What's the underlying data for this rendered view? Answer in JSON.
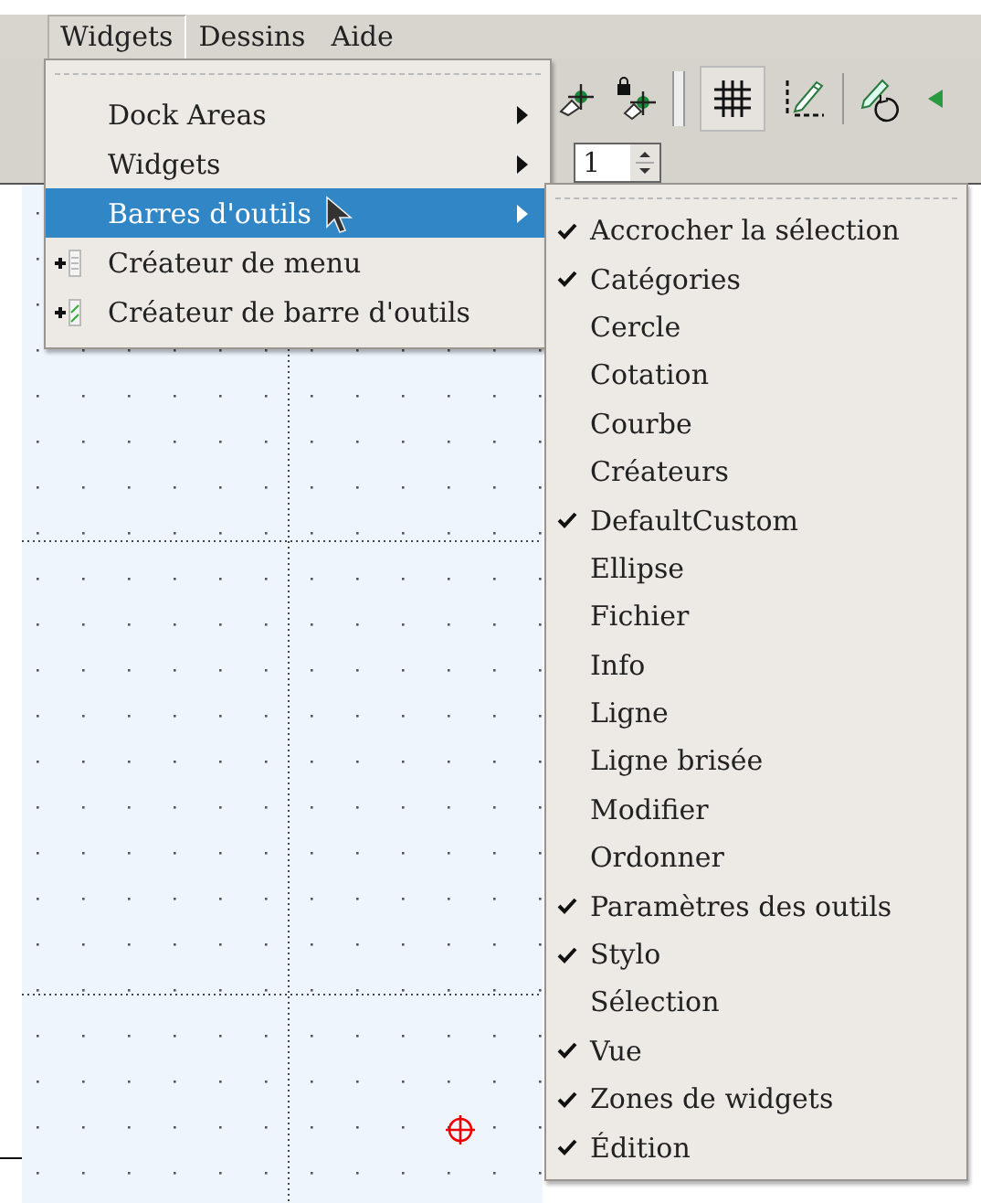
{
  "menubar": [
    {
      "label": "Widgets",
      "selected": true
    },
    {
      "label": "Dessins",
      "selected": false
    },
    {
      "label": "Aide",
      "selected": false
    }
  ],
  "toolbar": {
    "spin_value": "1"
  },
  "widgets_menu": [
    {
      "kind": "submenu",
      "label": "Dock Areas",
      "selected": false
    },
    {
      "kind": "submenu",
      "label": "Widgets",
      "selected": false
    },
    {
      "kind": "submenu",
      "label": "Barres d'outils",
      "selected": true
    },
    {
      "kind": "action",
      "label": "Créateur de menu",
      "selected": false
    },
    {
      "kind": "action",
      "label": "Créateur de barre d'outils",
      "selected": false
    }
  ],
  "toolbars_submenu": [
    {
      "label": "Accrocher la sélection",
      "checked": true
    },
    {
      "label": "Catégories",
      "checked": true
    },
    {
      "label": "Cercle",
      "checked": false
    },
    {
      "label": "Cotation",
      "checked": false
    },
    {
      "label": "Courbe",
      "checked": false
    },
    {
      "label": "Créateurs",
      "checked": false
    },
    {
      "label": "DefaultCustom",
      "checked": true
    },
    {
      "label": "Ellipse",
      "checked": false
    },
    {
      "label": "Fichier",
      "checked": false
    },
    {
      "label": "Info",
      "checked": false
    },
    {
      "label": "Ligne",
      "checked": false
    },
    {
      "label": "Ligne brisée",
      "checked": false
    },
    {
      "label": "Modifier",
      "checked": false
    },
    {
      "label": "Ordonner",
      "checked": false
    },
    {
      "label": "Paramètres des outils",
      "checked": true
    },
    {
      "label": "Stylo",
      "checked": true
    },
    {
      "label": "Sélection",
      "checked": false
    },
    {
      "label": "Vue",
      "checked": true
    },
    {
      "label": "Zones de widgets",
      "checked": true
    },
    {
      "label": "Édition",
      "checked": true
    }
  ]
}
